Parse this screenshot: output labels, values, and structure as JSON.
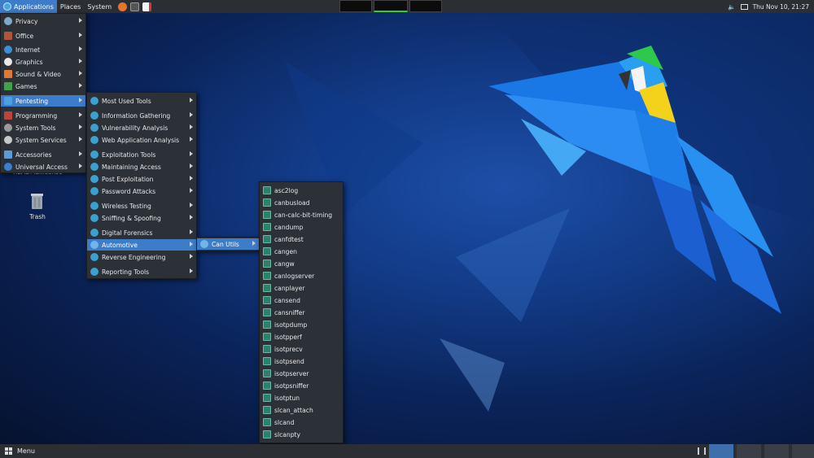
{
  "top_panel": {
    "applications": "Applications",
    "places": "Places",
    "system": "System",
    "clock": "Thu Nov 10, 21:27"
  },
  "desktop": {
    "readme_label": "README.license",
    "trash_label": "Trash"
  },
  "bottom_panel": {
    "menu_label": "Menu"
  },
  "apps_menu": {
    "items": [
      {
        "label": "Privacy",
        "color": "#7fa9c9"
      },
      {
        "label": "Office",
        "color": "#b2543a"
      },
      {
        "label": "Internet",
        "color": "#3a8fd6"
      },
      {
        "label": "Graphics",
        "color": "#e8e8e8"
      },
      {
        "label": "Sound & Video",
        "color": "#e07a2e"
      },
      {
        "label": "Games",
        "color": "#3fa34a"
      },
      {
        "label": "Pentesting",
        "color": "#4aa0e0"
      },
      {
        "label": "Programming",
        "color": "#c0423a"
      },
      {
        "label": "System Tools",
        "color": "#9a9a9a"
      },
      {
        "label": "System Services",
        "color": "#c8c8c8"
      },
      {
        "label": "Accessories",
        "color": "#5b9bd5"
      },
      {
        "label": "Universal Access",
        "color": "#3a7fd0"
      }
    ]
  },
  "pentest_menu": {
    "items": [
      {
        "label": "Most Used Tools"
      },
      {
        "label": "Information Gathering"
      },
      {
        "label": "Vulnerability Analysis"
      },
      {
        "label": "Web Application Analysis"
      },
      {
        "label": "Exploitation Tools"
      },
      {
        "label": "Maintaining Access"
      },
      {
        "label": "Post Exploitation"
      },
      {
        "label": "Password Attacks"
      },
      {
        "label": "Wireless Testing"
      },
      {
        "label": "Sniffing & Spoofing"
      },
      {
        "label": "Digital Forensics"
      },
      {
        "label": "Automotive"
      },
      {
        "label": "Reverse Engineering"
      },
      {
        "label": "Reporting Tools"
      }
    ]
  },
  "automotive_menu": {
    "items": [
      {
        "label": "Can Utils"
      }
    ]
  },
  "canutils_menu": {
    "items": [
      "asc2log",
      "canbusload",
      "can-calc-bit-timing",
      "candump",
      "canfdtest",
      "cangen",
      "cangw",
      "canlogserver",
      "canplayer",
      "cansend",
      "cansniffer",
      "isotpdump",
      "isotpperf",
      "isotprecv",
      "isotpsend",
      "isotpserver",
      "isotpsniffer",
      "isotptun",
      "slcan_attach",
      "slcand",
      "slcanpty"
    ]
  },
  "colors": {
    "panel": "#2b2e33",
    "menu_bg": "#2c3037",
    "highlight": "#3d7cc9"
  }
}
